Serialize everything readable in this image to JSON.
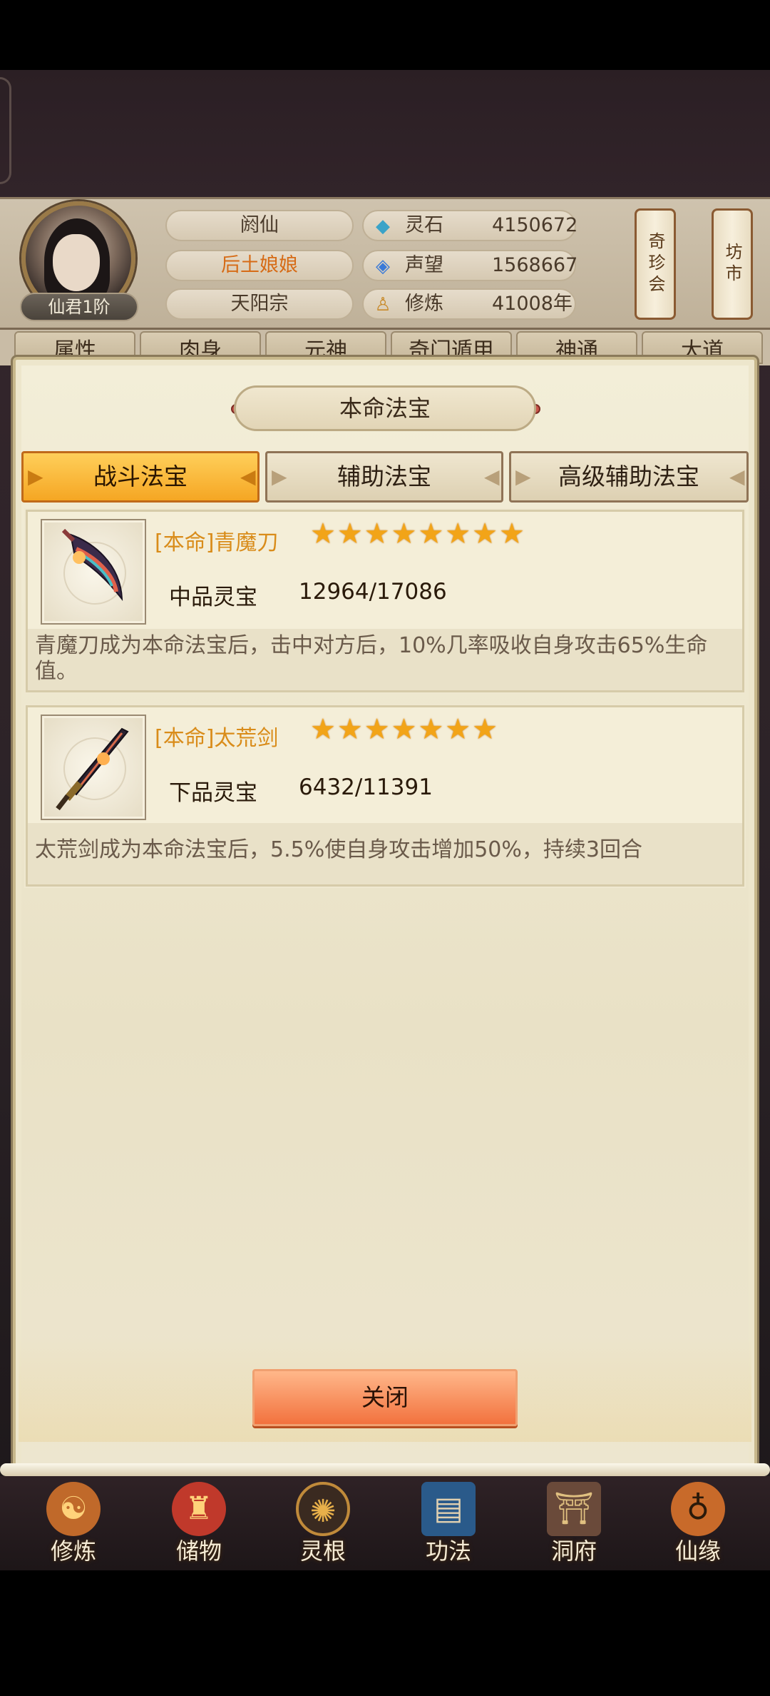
{
  "player": {
    "rank": "仙君1阶",
    "info": [
      "阏仙",
      "后土娘娘",
      "天阳宗"
    ]
  },
  "resources": [
    {
      "icon": "spirit-stone-icon",
      "label": "灵石",
      "value": "4150672"
    },
    {
      "icon": "reputation-icon",
      "label": "声望",
      "value": "1568667"
    },
    {
      "icon": "cultivation-icon",
      "label": "修炼",
      "value": "41008年"
    }
  ],
  "side_banners": [
    "奇珍会",
    "坊市"
  ],
  "top_tabs": [
    "属性",
    "肉身",
    "元神",
    "奇门遁甲",
    "神通",
    "大道"
  ],
  "modal": {
    "title": "本命法宝",
    "tabs": [
      "战斗法宝",
      "辅助法宝",
      "高级辅助法宝"
    ],
    "active_tab": 0,
    "items": [
      {
        "icon": "blade-icon",
        "name": "[本命]青魔刀",
        "stars": 8,
        "grade": "中品灵宝",
        "exp": "12964/17086",
        "desc": "青魔刀成为本命法宝后，击中对方后，10%几率吸收自身攻击65%生命值。"
      },
      {
        "icon": "sword-icon",
        "name": "[本命]太荒剑",
        "stars": 7,
        "grade": "下品灵宝",
        "exp": "6432/11391",
        "desc": "太荒剑成为本命法宝后，5.5%使自身攻击增加50%，持续3回合"
      }
    ],
    "close_label": "关闭"
  },
  "bottom_nav": [
    {
      "label": "修炼",
      "icon": "meditation-icon"
    },
    {
      "label": "储物",
      "icon": "bag-icon"
    },
    {
      "label": "灵根",
      "icon": "spirit-root-icon"
    },
    {
      "label": "功法",
      "icon": "book-icon"
    },
    {
      "label": "洞府",
      "icon": "cave-icon"
    },
    {
      "label": "仙缘",
      "icon": "gourd-icon"
    }
  ],
  "colors": {
    "accent_gold": "#f5a623",
    "item_name": "#d98c1a",
    "close_button": "#f2723e"
  }
}
